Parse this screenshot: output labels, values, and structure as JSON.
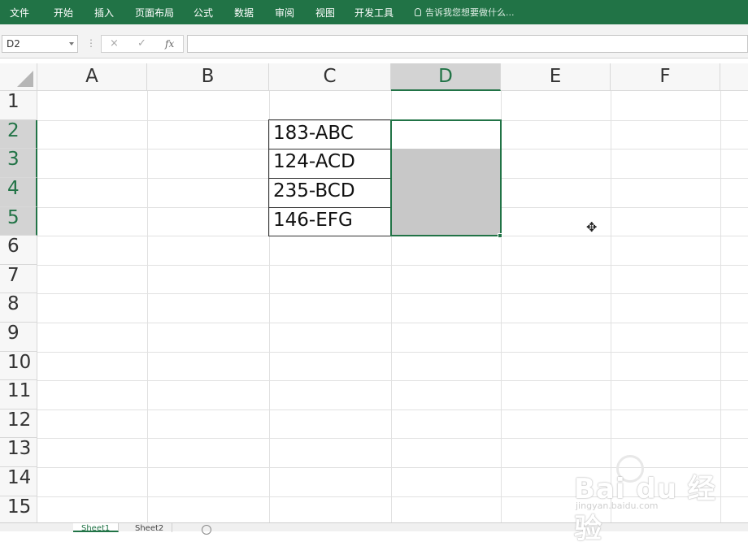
{
  "ribbon": {
    "tabs": [
      "文件",
      "开始",
      "插入",
      "页面布局",
      "公式",
      "数据",
      "审阅",
      "视图",
      "开发工具"
    ],
    "tell_me": "告诉我您想要做什么..."
  },
  "formula_bar": {
    "name_box": "D2",
    "cancel_glyph": "×",
    "enter_glyph": "✓",
    "fx_label": "fx",
    "formula": ""
  },
  "grid": {
    "columns": [
      "A",
      "B",
      "C",
      "D",
      "E",
      "F"
    ],
    "selected_column": "D",
    "rows": [
      "1",
      "2",
      "3",
      "4",
      "5",
      "6",
      "7",
      "8",
      "9",
      "10",
      "11",
      "12",
      "13",
      "14",
      "15"
    ],
    "selected_rows": [
      "2",
      "3",
      "4",
      "5"
    ],
    "active_cell": "D2",
    "selection": "D2:D5",
    "cells": {
      "C2": "183-ABC",
      "C3": "124-ACD",
      "C4": "235-BCD",
      "C5": "146-EFG"
    }
  },
  "sheets": {
    "tabs": [
      "Sheet1",
      "Sheet2"
    ],
    "active": "Sheet1"
  },
  "watermark": {
    "logo": "Bai du 经验",
    "url": "jingyan.baidu.com"
  },
  "colors": {
    "brand": "#217346",
    "selection_fill": "#c8c8c8"
  }
}
